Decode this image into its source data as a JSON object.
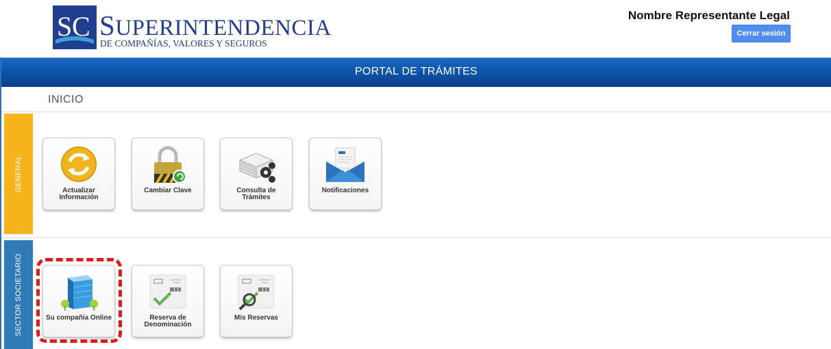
{
  "header": {
    "logo_word_cap": "S",
    "logo_word_rest": "UPERINTENDENCIA",
    "logo_sub": "DE COMPAÑÍAS, VALORES Y SEGUROS",
    "user_name": "Nombre Representante Legal",
    "logout_label": "Cerrar sesión"
  },
  "banner": {
    "title": "PORTAL DE TRÁMITES"
  },
  "breadcrumb": {
    "current": "INICIO"
  },
  "sections": {
    "general": {
      "label": "GENERAL",
      "color": "#f7b31a",
      "tiles": [
        {
          "label": "Actualizar Información",
          "icon": "refresh-icon"
        },
        {
          "label": "Cambiar Clave",
          "icon": "padlock-icon"
        },
        {
          "label": "Consulta de Trámites",
          "icon": "documents-gears-icon"
        },
        {
          "label": "Notificaciones",
          "icon": "envelope-icon"
        }
      ]
    },
    "societario": {
      "label": "SECTOR SOCIETARIO",
      "color": "#2f7ab7",
      "tiles": [
        {
          "label": "Su compañía Online",
          "icon": "building-icon"
        },
        {
          "label": "Reserva de Denominación",
          "icon": "document-check-icon"
        },
        {
          "label": "Mis Reservas",
          "icon": "document-search-icon"
        }
      ]
    }
  },
  "colors": {
    "brand_blue": "#1f3e8f",
    "banner_blue": "#0d55ad",
    "button_blue": "#4f8ef0",
    "highlight_red": "#e11b1b"
  }
}
